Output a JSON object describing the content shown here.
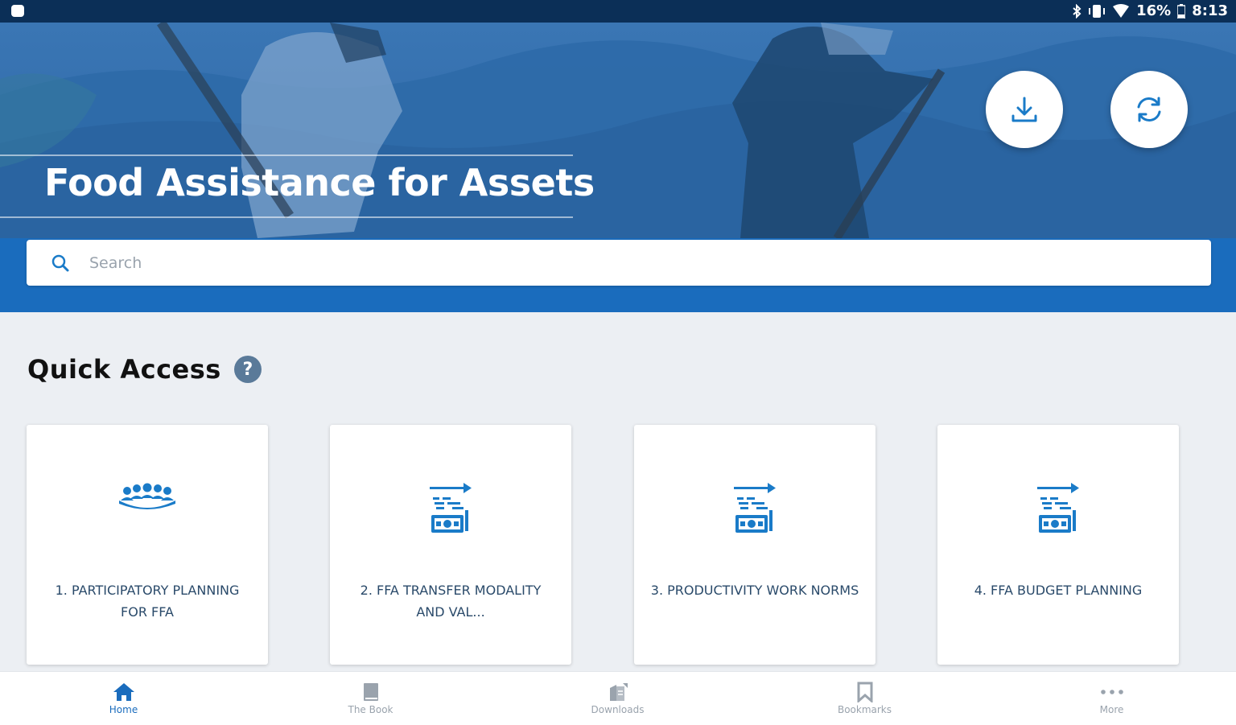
{
  "status_bar": {
    "battery_percent": "16%",
    "time": "8:13",
    "icons": [
      "bluetooth-icon",
      "vibrate-icon",
      "wifi-icon",
      "battery-icon"
    ]
  },
  "header": {
    "title": "Food Assistance for Assets",
    "download_button_icon": "download-icon",
    "sync_button_icon": "sync-icon",
    "background": "farmers-digging-photo"
  },
  "search": {
    "placeholder": "Search",
    "value": ""
  },
  "quick_access": {
    "heading": "Quick Access",
    "help_symbol": "?",
    "cards": [
      {
        "label": "1. PARTICIPATORY PLANNING FOR FFA",
        "icon": "group-people-icon"
      },
      {
        "label": "2. FFA TRANSFER MODALITY AND VAL...",
        "icon": "cash-transfer-icon"
      },
      {
        "label": "3. PRODUCTIVITY WORK NORMS",
        "icon": "cash-transfer-icon"
      },
      {
        "label": "4. FFA BUDGET PLANNING",
        "icon": "cash-transfer-icon"
      }
    ]
  },
  "bottom_nav": {
    "items": [
      {
        "label": "Home",
        "icon": "home-icon",
        "active": true
      },
      {
        "label": "The Book",
        "icon": "book-icon",
        "active": false
      },
      {
        "label": "Downloads",
        "icon": "downloads-icon",
        "active": false
      },
      {
        "label": "Bookmarks",
        "icon": "bookmark-icon",
        "active": false
      },
      {
        "label": "More",
        "icon": "more-icon",
        "active": false
      }
    ]
  },
  "colors": {
    "status_bar": "#0b2f57",
    "hero_blue": "#1a6cbd",
    "page_background": "#eceff3",
    "accent": "#1a7bc8",
    "inactive_nav": "#9aa3ad"
  }
}
